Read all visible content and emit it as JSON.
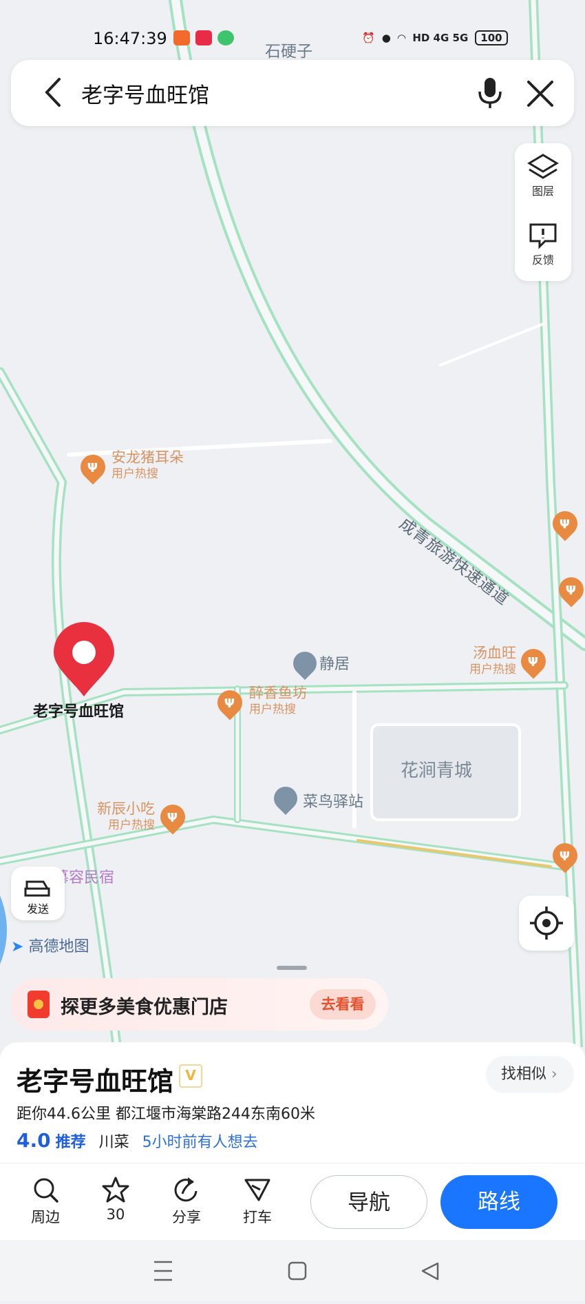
{
  "status_bar": {
    "time": "16:47:39",
    "network": "HD 4G 5G",
    "battery": "100"
  },
  "search": {
    "query": "老字号血旺馆"
  },
  "side_buttons": {
    "layers": "图层",
    "feedback": "反馈"
  },
  "map": {
    "top_label": "石硬子",
    "road_label": "成青旅游快速通道",
    "district_label": "花涧青城",
    "pois": [
      {
        "name": "安龙猪耳朵",
        "tag": "用户热搜"
      },
      {
        "name": "汤血旺",
        "tag": "用户热搜"
      },
      {
        "name": "醉香鱼坊",
        "tag": "用户热搜"
      },
      {
        "name": "新辰小吃",
        "tag": "用户热搜"
      }
    ],
    "places": [
      "静居",
      "菜鸟驿站",
      "慕容民宿"
    ],
    "selected_label": "老字号血旺馆",
    "send_label": "发送",
    "brand": "高德地图"
  },
  "promo": {
    "text": "探更多美食优惠门店",
    "button": "去看看"
  },
  "detail": {
    "name": "老字号血旺馆",
    "badge": "V",
    "similar": "找相似",
    "address": "距你44.6公里  都江堰市海棠路244东南60米",
    "rating": "4.0",
    "recommend": "推荐",
    "category": "川菜",
    "activity": "5小时前有人想去"
  },
  "bottom_bar": {
    "nearby": "周边",
    "favorite_count": "30",
    "share": "分享",
    "taxi": "打车",
    "navigate": "导航",
    "route": "路线"
  },
  "colors": {
    "accent": "#1a75ff",
    "poi": "#e98a42",
    "road": "#9fe0bd",
    "pin": "#e8303f"
  }
}
